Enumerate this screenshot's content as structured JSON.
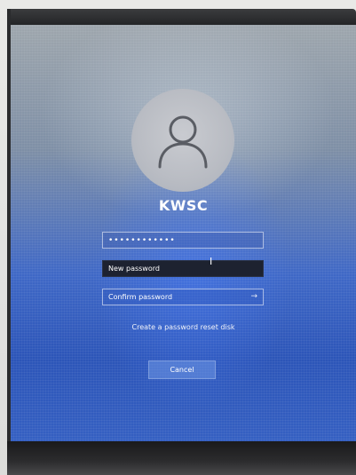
{
  "user": {
    "name": "KWSC",
    "avatar_icon": "person-icon"
  },
  "form": {
    "old_password_value": "••••••••••••",
    "new_password_placeholder": "New password",
    "confirm_password_placeholder": "Confirm password",
    "submit_icon": "→"
  },
  "links": {
    "reset_disk": "Create a password reset disk"
  },
  "buttons": {
    "cancel": "Cancel"
  },
  "colors": {
    "screen_blue": "#2c55b8",
    "active_field": "#1d2230",
    "text": "#ffffff"
  }
}
